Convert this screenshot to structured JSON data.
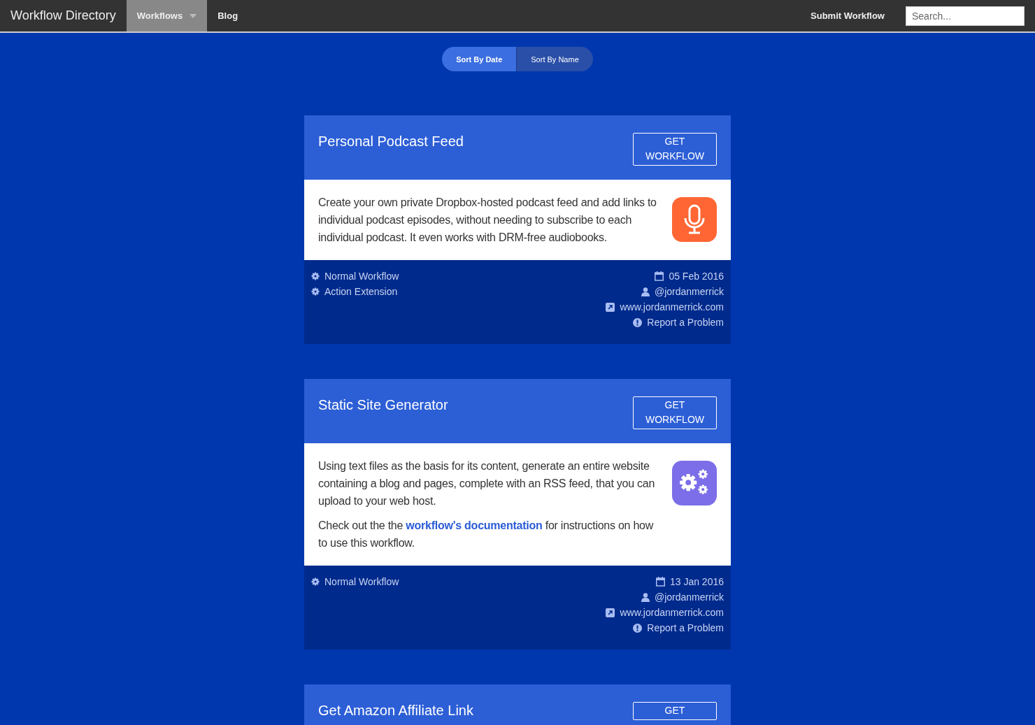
{
  "navbar": {
    "brand": "Workflow Directory",
    "items": [
      {
        "label": "Workflows",
        "selected": true,
        "dropdown": true
      },
      {
        "label": "Blog",
        "selected": false,
        "dropdown": false
      }
    ],
    "submit": "Submit Workflow",
    "search": {
      "placeholder": "Search..."
    }
  },
  "sort": [
    {
      "label": "Sort By Date",
      "selected": true
    },
    {
      "label": "Sort By Name",
      "selected": false
    }
  ],
  "cards": [
    {
      "title": "Personal Podcast Feed",
      "button": [
        "GET",
        "WORKFLOW"
      ],
      "icon": {
        "kind": "mic",
        "color": "#ff6633"
      },
      "paragraphs": [
        [
          {
            "kind": "text",
            "text": "Create your own private Dropbox-hosted podcast feed and add links to individual podcast episodes, without needing to subscribe to each individual podcast. It even works with DRM-free audiobooks."
          }
        ]
      ],
      "tags": [
        "Normal Workflow",
        "Action Extension"
      ],
      "meta": [
        {
          "kind": "date",
          "text": "05 Feb 2016"
        },
        {
          "kind": "author",
          "text": "@jordanmerrick"
        },
        {
          "kind": "website",
          "text": "www.jordanmerrick.com"
        },
        {
          "kind": "report",
          "text": "Report a Problem"
        }
      ]
    },
    {
      "title": "Static Site Generator",
      "button": [
        "GET",
        "WORKFLOW"
      ],
      "icon": {
        "kind": "gears",
        "color": "#7b6ee8"
      },
      "paragraphs": [
        [
          {
            "kind": "text",
            "text": "Using text files as the basis for its content, generate an entire website containing a blog and pages, complete with an RSS feed, that you can upload to your web host."
          }
        ],
        [
          {
            "kind": "text",
            "text": "Check out the the "
          },
          {
            "kind": "link",
            "text": "workflow's documentation"
          },
          {
            "kind": "text",
            "text": " for instructions on how to use this workflow."
          }
        ]
      ],
      "tags": [
        "Normal Workflow"
      ],
      "meta": [
        {
          "kind": "date",
          "text": "13 Jan 2016"
        },
        {
          "kind": "author",
          "text": "@jordanmerrick"
        },
        {
          "kind": "website",
          "text": "www.jordanmerrick.com"
        },
        {
          "kind": "report",
          "text": "Report a Problem"
        }
      ]
    },
    {
      "title": "Get Amazon Affiliate Link",
      "button": [
        "GET"
      ]
    }
  ]
}
